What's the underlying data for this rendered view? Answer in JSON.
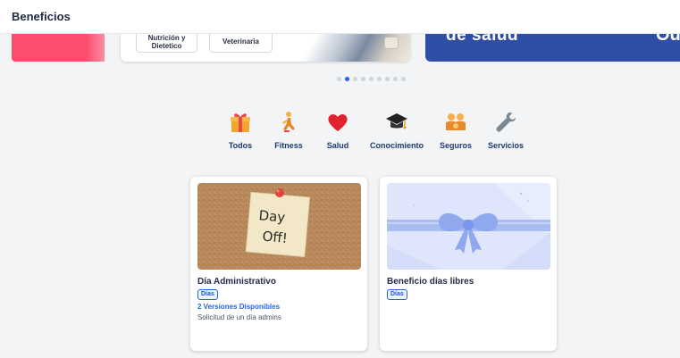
{
  "header": {
    "title": "Beneficios"
  },
  "carousel": {
    "chip_a": "Nutrición y Dietetico",
    "chip_b": "Veterinaria",
    "blue_text": "de salud",
    "blue_text2": "Ou",
    "dots": [
      false,
      true,
      false,
      false,
      false,
      false,
      false,
      false,
      false
    ],
    "colors": {
      "red": "#fb4d6d",
      "blue": "#2f4fa6"
    }
  },
  "categories": [
    {
      "label": "Todos",
      "icon": "gift-icon"
    },
    {
      "label": "Fitness",
      "icon": "runner-icon"
    },
    {
      "label": "Salud",
      "icon": "heart-icon"
    },
    {
      "label": "Conocimiento",
      "icon": "graduation-cap-icon"
    },
    {
      "label": "Seguros",
      "icon": "family-icon"
    },
    {
      "label": "Servicios",
      "icon": "wrench-icon"
    }
  ],
  "cards": [
    {
      "title": "Día Administrativo",
      "tag": "Días",
      "versions": "2 Versiones Disponibles",
      "description": "Solicitud de un día admins",
      "note_text_1": "Day",
      "note_text_2": "Off!"
    },
    {
      "title": "Beneficio días libres",
      "tag": "Días"
    }
  ],
  "accent": "#2563eb"
}
